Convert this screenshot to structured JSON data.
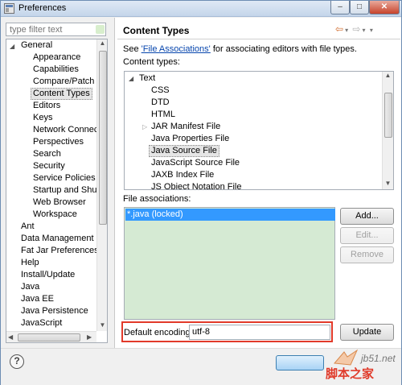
{
  "window": {
    "title": "Preferences",
    "controls": [
      "–",
      "□",
      "✕"
    ]
  },
  "filter": {
    "placeholder": "type filter text"
  },
  "tree": {
    "items": [
      {
        "label": "General",
        "expanded": true,
        "level": 0
      },
      {
        "label": "Appearance",
        "level": 1
      },
      {
        "label": "Capabilities",
        "level": 1
      },
      {
        "label": "Compare/Patch",
        "level": 1
      },
      {
        "label": "Content Types",
        "level": 1,
        "selected": true
      },
      {
        "label": "Editors",
        "level": 1
      },
      {
        "label": "Keys",
        "level": 1
      },
      {
        "label": "Network Connectio",
        "level": 1
      },
      {
        "label": "Perspectives",
        "level": 1
      },
      {
        "label": "Search",
        "level": 1
      },
      {
        "label": "Security",
        "level": 1
      },
      {
        "label": "Service Policies",
        "level": 1
      },
      {
        "label": "Startup and Shutd",
        "level": 1
      },
      {
        "label": "Web Browser",
        "level": 1
      },
      {
        "label": "Workspace",
        "level": 1
      },
      {
        "label": "Ant",
        "level": 0
      },
      {
        "label": "Data Management",
        "level": 0
      },
      {
        "label": "Fat Jar Preferences",
        "level": 0
      },
      {
        "label": "Help",
        "level": 0
      },
      {
        "label": "Install/Update",
        "level": 0
      },
      {
        "label": "Java",
        "level": 0
      },
      {
        "label": "Java EE",
        "level": 0
      },
      {
        "label": "Java Persistence",
        "level": 0
      },
      {
        "label": "JavaScript",
        "level": 0
      }
    ]
  },
  "page": {
    "title": "Content Types",
    "desc_prefix": "See ",
    "desc_link": "'File Associations'",
    "desc_suffix": " for associating editors with file types.",
    "content_types_label": "Content types:",
    "content_types": {
      "root": "Text",
      "children": [
        "CSS",
        "DTD",
        "HTML",
        "JAR Manifest File",
        "Java Properties File",
        "Java Source File",
        "JavaScript Source File",
        "JAXB Index File",
        "JS Object Notation File"
      ],
      "selected": "Java Source File"
    },
    "file_assoc_label": "File associations:",
    "file_assoc_items": [
      "*.java (locked)"
    ],
    "buttons": {
      "add": "Add...",
      "edit": "Edit...",
      "remove": "Remove",
      "update": "Update"
    },
    "encoding_label": "Default encoding:",
    "encoding_value": "utf-8"
  },
  "watermark": {
    "site": "jb51.net",
    "cn": "脚本之家"
  }
}
